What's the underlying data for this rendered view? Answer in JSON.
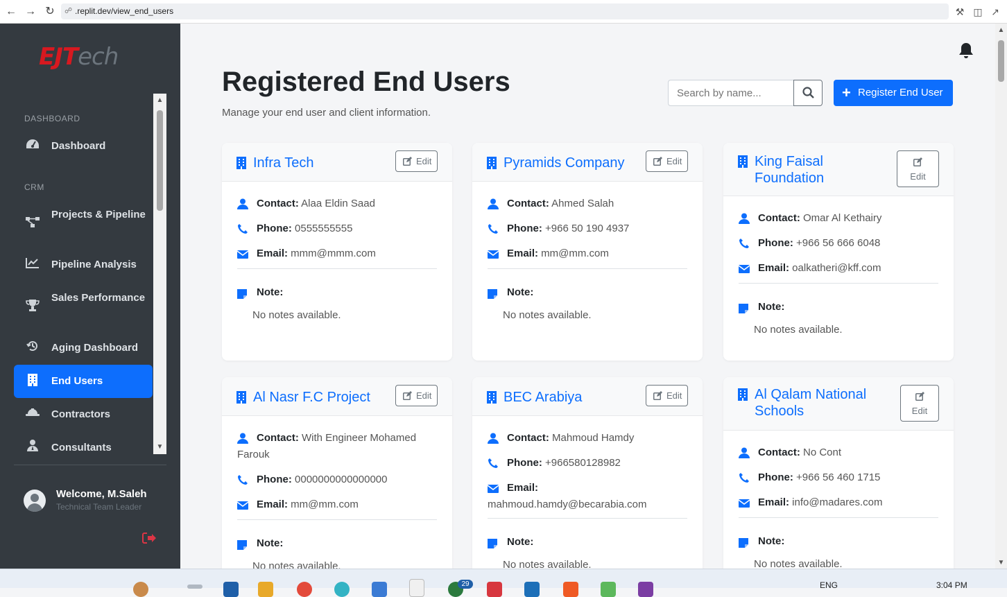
{
  "browser": {
    "url": ".replit.dev/view_end_users"
  },
  "sidebar": {
    "logo_main": "EJT",
    "logo_tail": "ech",
    "sections": [
      {
        "label": "DASHBOARD"
      },
      {
        "label": "CRM"
      }
    ],
    "items": [
      {
        "label": "Dashboard",
        "icon": "gauge-icon"
      },
      {
        "label": "Projects & Pipeline",
        "icon": "project-diagram-icon"
      },
      {
        "label": "Pipeline Analysis",
        "icon": "line-chart-icon"
      },
      {
        "label": "Sales Performance",
        "icon": "trophy-icon"
      },
      {
        "label": "Aging Dashboard",
        "icon": "history-icon"
      },
      {
        "label": "End Users",
        "icon": "building-icon",
        "active": true
      },
      {
        "label": "Contractors",
        "icon": "hard-hat-icon"
      },
      {
        "label": "Consultants",
        "icon": "user-tie-icon"
      }
    ],
    "user": {
      "welcome": "Welcome, M.Saleh",
      "role": "Technical Team Leader"
    }
  },
  "header": {
    "title": "Registered End Users",
    "subtitle": "Manage your end user and client information.",
    "search_placeholder": "Search by name...",
    "register_label": "Register End User"
  },
  "labels": {
    "contact": "Contact:",
    "phone": "Phone:",
    "email": "Email:",
    "note": "Note:",
    "edit": "Edit"
  },
  "cards": [
    {
      "name": "Infra Tech",
      "contact": "Alaa Eldin Saad",
      "phone": "0555555555",
      "email": "mmm@mmm.com",
      "note": "No notes available."
    },
    {
      "name": "Pyramids Company",
      "contact": "Ahmed Salah",
      "phone": "+966 50 190 4937",
      "email": "mm@mm.com",
      "note": "No notes available."
    },
    {
      "name": "King Faisal Foundation",
      "contact": "Omar Al Kethairy",
      "phone": "+966 56 666 6048",
      "email": "oalkatheri@kff.com",
      "note": "No notes available."
    },
    {
      "name": "Al Nasr F.C Project",
      "contact": "With Engineer Mohamed Farouk",
      "phone": "0000000000000000",
      "email": "mm@mm.com",
      "note": "No notes available."
    },
    {
      "name": "BEC Arabiya",
      "contact": "Mahmoud Hamdy",
      "phone": "+966580128982",
      "email": "mahmoud.hamdy@becarabia.com",
      "note": "No notes available."
    },
    {
      "name": "Al Qalam National Schools",
      "contact": "No Cont",
      "phone": "+966 56 460 1715",
      "email": "info@madares.com",
      "note": "No notes available."
    }
  ],
  "taskbar": {
    "lang": "ENG",
    "time": "3:04 PM",
    "badge": "29"
  },
  "colors": {
    "primary": "#0d6efd",
    "sidebar": "#343a40",
    "logo_red": "#d71920"
  }
}
